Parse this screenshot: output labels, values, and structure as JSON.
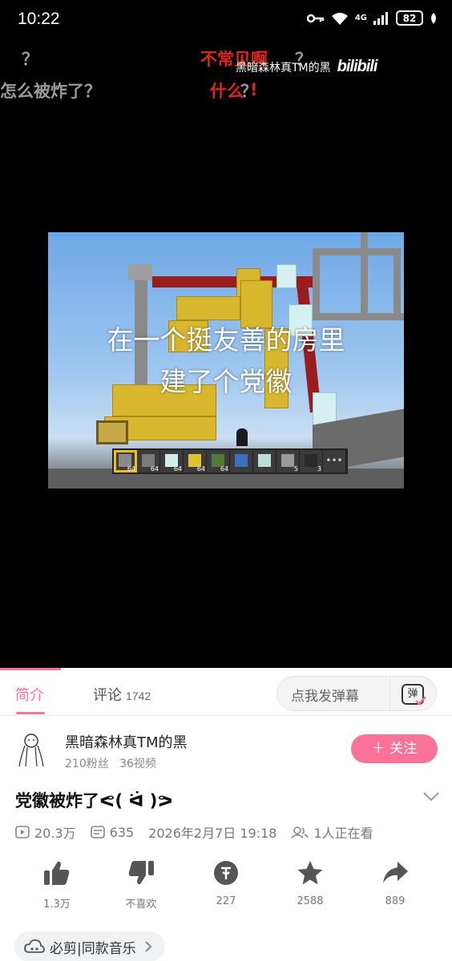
{
  "status_bar": {
    "time": "10:22",
    "network": "4G",
    "battery": "82"
  },
  "danmaku": [
    {
      "text": "？",
      "color": "#9a9a9a"
    },
    {
      "text": "怎么被炸了？",
      "color": "#9a9a9a"
    },
    {
      "text": "不常见啊",
      "color": "#e0241b"
    },
    {
      "text": "？",
      "color": "#9a9a9a"
    },
    {
      "text": "什么",
      "color": "#e0241b"
    },
    {
      "text": "？",
      "color": "#9a9a9a"
    },
    {
      "text": "!",
      "color": "#e0241b"
    }
  ],
  "watermark": {
    "author": "黑暗森林真TM的黑",
    "logo": "bilibili"
  },
  "video": {
    "subtitle_line1": "在一个挺友善的房里",
    "subtitle_line2": "建了个党徽",
    "hotbar_counts": [
      "64",
      "64",
      "64",
      "64",
      "64",
      "",
      "",
      "5",
      "3"
    ],
    "progress": 0.135
  },
  "tabs": {
    "intro_label": "简介",
    "comments_label": "评论",
    "comments_count": "1742",
    "danmaku_placeholder": "点我发弹幕",
    "danmaku_button": "弹"
  },
  "uploader": {
    "name": "黑暗森林真TM的黑",
    "followers": "210粉丝",
    "videos": "36视频",
    "follow_label": "＋ 关注"
  },
  "video_info": {
    "title": "党徽被炸了ᕙ( ᐛ )ᕗ",
    "views": "20.3万",
    "danmaku_count": "635",
    "date": "2026年2月7日 19:18",
    "watching": "1人正在看"
  },
  "actions": {
    "like": "1.3万",
    "dislike": "不喜欢",
    "coin": "227",
    "favorite": "2588",
    "share": "889"
  },
  "music": {
    "label": "必剪|同款音乐"
  },
  "colors": {
    "accent": "#fb7299",
    "danmaku_red": "#e0241b",
    "danmaku_gray": "#9a9a9a"
  }
}
